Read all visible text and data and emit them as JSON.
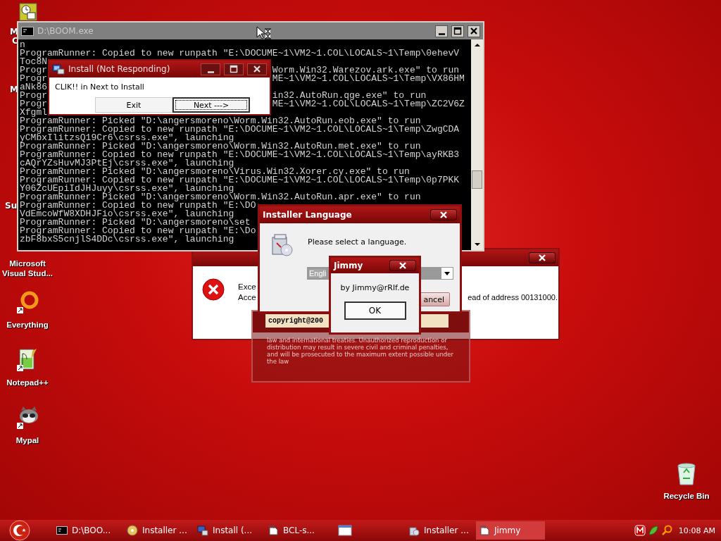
{
  "desktop": {
    "partial_labels": [
      "M",
      "C",
      "M",
      "Su"
    ],
    "icons": [
      {
        "kind": "none",
        "lines": [
          "Microsoft",
          "Visual Stud..."
        ]
      },
      {
        "kind": "ring",
        "lines": [
          "Everything"
        ]
      },
      {
        "kind": "notepad",
        "lines": [
          "Notepad++"
        ]
      },
      {
        "kind": "mascot",
        "lines": [
          "Mypal"
        ]
      },
      {
        "kind": "bin",
        "lines": [
          "Recycle Bin"
        ]
      }
    ]
  },
  "console": {
    "title": "D:\\BOOM.exe",
    "active": false,
    "lines": [
      {
        "text": "n"
      },
      {
        "text": "ProgramRunner: Copied to new runpath \"E:\\DOCUME~1\\VM2~1.COL\\LOCALS~1\\Temp\\0ehevV"
      },
      {
        "text": "Toc8N"
      },
      {
        "text": "Progr",
        "tail": "Worm.Win32.Warezov.ark.exe\" to run"
      },
      {
        "text": "Progr",
        "tail": "ME~1\\VM2~1.COL\\LOCALS~1\\Temp\\VX86HM"
      },
      {
        "text": "aNk86"
      },
      {
        "text": "Progr",
        "tail": "in32.AutoRun.qge.exe\" to run"
      },
      {
        "text": "Progr",
        "tail": "ME~1\\VM2~1.COL\\LOCALS~1\\Temp\\ZC2V6Z"
      },
      {
        "text": "Xfgml"
      },
      {
        "text": "ProgramRunner: Picked \"D:\\angersmoreno\\Worm.Win32.AutoRun.eob.exe\" to run"
      },
      {
        "text": "ProgramRunner: Copied to new runpath \"E:\\DOCUME~1\\VM2~1.COL\\LOCALS~1\\Temp\\ZwgCDA"
      },
      {
        "text": "yCMbxIlitzsQ19Cr6\\csrss.exe\", launching"
      },
      {
        "text": "ProgramRunner: Picked \"D:\\angersmoreno\\Worm.Win32.AutoRun.met.exe\" to run"
      },
      {
        "text": "ProgramRunner: Copied to new runpath \"E:\\DOCUME~1\\VM2~1.COL\\LOCALS~1\\Temp\\ayRKB3"
      },
      {
        "text": "cAQrYZsHuvMJ3PtEj\\csrss.exe\", launching"
      },
      {
        "text": "ProgramRunner: Picked \"D:\\angersmoreno\\Virus.Win32.Xorer.cy.exe\" to run"
      },
      {
        "text": "ProgramRunner: Copied to new runpath \"E:\\DOCUME~1\\VM2~1.COL\\LOCALS~1\\Temp\\0p7PKK"
      },
      {
        "text": "Y06ZcUEpiIdJHJuyy\\csrss.exe\", launching"
      },
      {
        "text": "ProgramRunner: Picked \"D:\\angersmoreno\\Worm.Win32.AutoRun.apr.exe\" to run"
      },
      {
        "text": "ProgramRunner: Copied to new runpath \"E:\\DO"
      },
      {
        "text": "VdEmcoWfW8XDHJFio\\csrss.exe\", launching"
      },
      {
        "text": "ProgramRunner: Picked \"D:\\angersmoreno\\set"
      },
      {
        "text": "ProgramRunner: Copied to new runpath \"E:\\Do"
      },
      {
        "text": "zbF8bxS5cnjlS4DDc\\csrss.exe\", launching"
      }
    ]
  },
  "install": {
    "title": "Install (Not Responding)",
    "message": "CLIK!! in Next to Install",
    "buttons": [
      {
        "label": "Exit",
        "focused": false
      },
      {
        "label": "Next --->",
        "focused": true
      }
    ]
  },
  "error": {
    "line_starts": [
      "Exce",
      "Acce"
    ],
    "line_end": "ead of address 00131000."
  },
  "splash": {
    "stamp": "copyright@200",
    "notice": "law and international treaties. Unauthorized reproduction or distribution may result in severe civil and criminal penalties, and will be prosecuted to the maximum extent possible under the law"
  },
  "language": {
    "title": "Installer Language",
    "prompt": "Please select a language.",
    "value": "Engli",
    "button": "ancel"
  },
  "jimmy": {
    "title": "Jimmy",
    "message": "by Jimmy@rRlf.de",
    "button": "OK"
  },
  "taskbar": {
    "items": [
      {
        "label": "D:\\BOO...",
        "kind": "console",
        "selected": false
      },
      {
        "label": "Installer ...",
        "kind": "disc",
        "selected": false
      },
      {
        "label": "Install (...",
        "kind": "setup",
        "selected": false
      },
      {
        "label": "BCL-s...",
        "kind": "doc",
        "selected": false
      },
      {
        "kind": "window",
        "selected": false
      },
      {
        "label": "Installer ...",
        "kind": "box",
        "selected": false
      },
      {
        "label": "Jimmy",
        "kind": "doc",
        "selected": true
      }
    ],
    "clock": "10:08 AM"
  }
}
